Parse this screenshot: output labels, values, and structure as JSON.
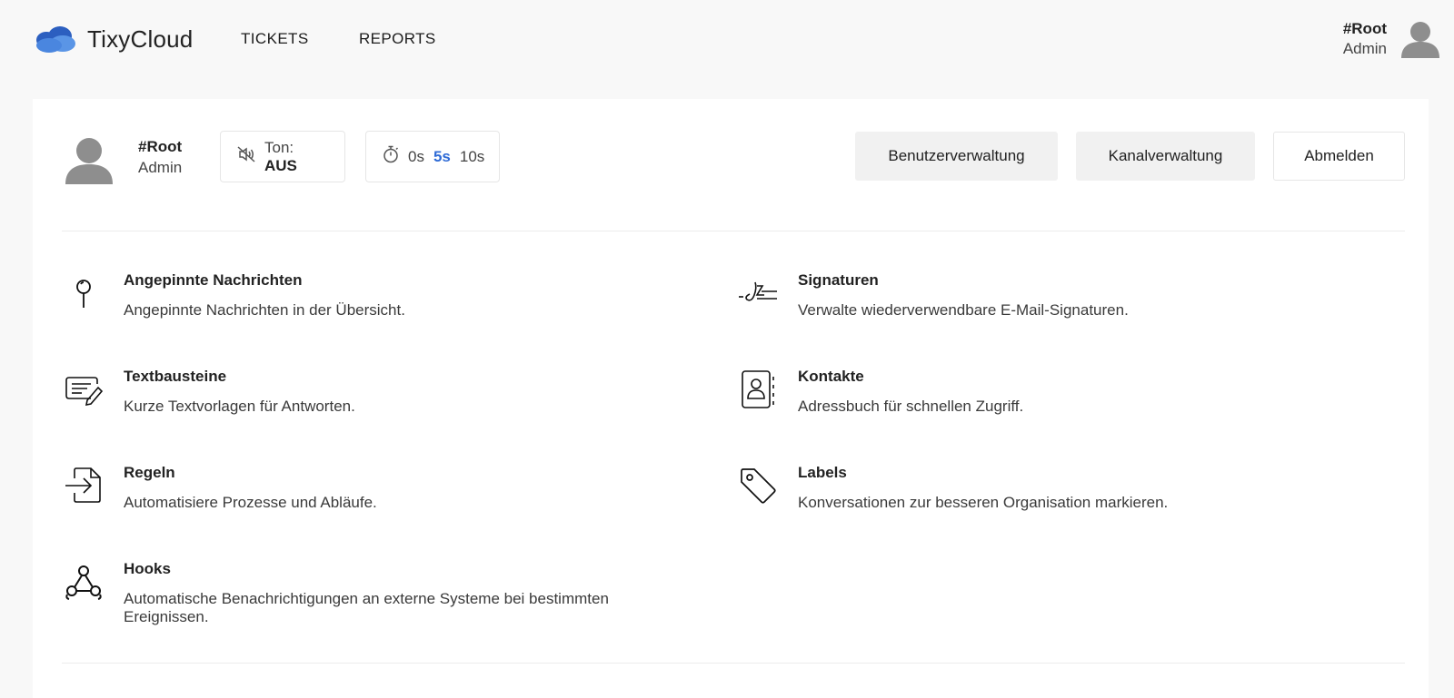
{
  "app": {
    "name": "TixyCloud",
    "brand_colors": {
      "cloud_dark": "#2c5fc0",
      "cloud_light": "#5a95e6"
    }
  },
  "nav": {
    "tickets": "TICKETS",
    "reports": "REPORTS"
  },
  "top_user": {
    "name": "#Root",
    "role": "Admin",
    "avatar_icon": "user-avatar-icon"
  },
  "card_user": {
    "name": "#Root",
    "role": "Admin"
  },
  "sound": {
    "icon": "volume-off-icon",
    "label": "Ton:",
    "value": "AUS"
  },
  "refresh": {
    "icon": "stopwatch-icon",
    "options": [
      "0s",
      "5s",
      "10s"
    ],
    "selected": "5s",
    "accent": "#2f6bd6"
  },
  "actions": {
    "user_management": "Benutzerverwaltung",
    "channel_management": "Kanalverwaltung",
    "logout": "Abmelden"
  },
  "features": [
    {
      "icon": "pin-icon",
      "title": "Angepinnte Nachrichten",
      "description": "Angepinnte Nachrichten in der Übersicht."
    },
    {
      "icon": "signature-icon",
      "title": "Signaturen",
      "description": "Verwalte wiederverwendbare E-Mail-Signaturen."
    },
    {
      "icon": "text-template-icon",
      "title": "Textbausteine",
      "description": "Kurze Textvorlagen für Antworten."
    },
    {
      "icon": "contacts-icon",
      "title": "Kontakte",
      "description": "Adressbuch für schnellen Zugriff."
    },
    {
      "icon": "rules-icon",
      "title": "Regeln",
      "description": "Automatisiere Prozesse und Abläufe."
    },
    {
      "icon": "tag-icon",
      "title": "Labels",
      "description": "Konversationen zur besseren Organisation markieren."
    },
    {
      "icon": "webhook-icon",
      "title": "Hooks",
      "description": "Automatische Benachrichtigungen an externe Systeme bei bestimmten Ereignissen."
    }
  ]
}
